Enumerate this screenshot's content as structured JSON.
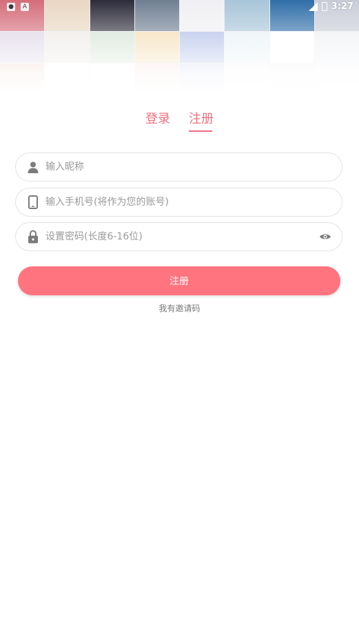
{
  "status_bar": {
    "time": "3:27",
    "left_icons": [
      "shield-icon",
      "a-icon"
    ]
  },
  "header": {
    "tile_colors": [
      "#d56c7a",
      "#e9d7c3",
      "#2d2c3a",
      "#6f7f92",
      "#f0f0f4",
      "#a8c5d9",
      "#2f6ea8",
      "#c9ccd8",
      "#d9d0e2",
      "#ece7e4",
      "#cfe0cf",
      "#f2d8a8",
      "#a7b7e6",
      "#e6f0f4",
      "#ffffff",
      "#eceff2",
      "#e7c7b8",
      "#ffffff",
      "#ffffff",
      "#f2d7cf",
      "#c6cde6",
      "#f8f6f6",
      "#eef0f6",
      "#f5f5f7"
    ]
  },
  "tabs": {
    "login": "登录",
    "register": "注册"
  },
  "form": {
    "nickname_placeholder": "输入昵称",
    "phone_placeholder": "输入手机号(将作为您的账号)",
    "password_placeholder": "设置密码(长度6-16位)",
    "submit_label": "注册",
    "invite_link": "我有邀请码"
  },
  "colors": {
    "accent": "#ff747f",
    "tab_text": "#f0707f",
    "icon": "#7b7b7b"
  }
}
